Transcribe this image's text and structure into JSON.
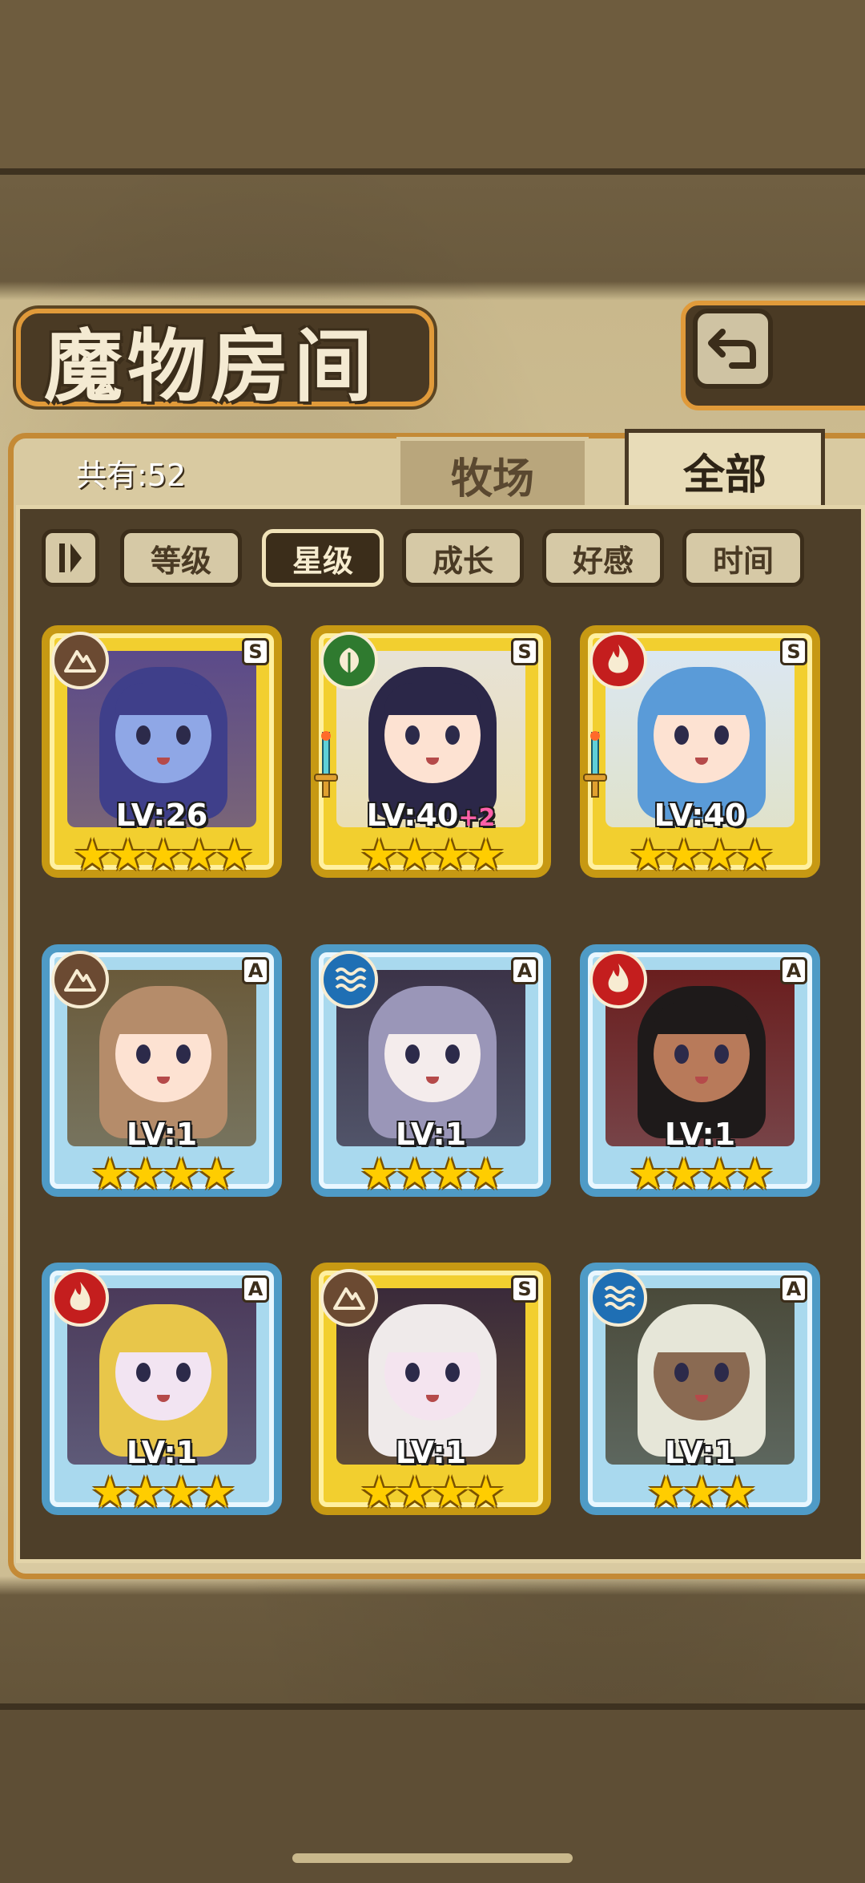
{
  "title": "魔物房间",
  "count_label": "共有:52",
  "tabs": [
    {
      "label": "牧场",
      "active": false
    },
    {
      "label": "全部",
      "active": true
    }
  ],
  "sort_buttons": [
    {
      "label": "等级",
      "active": false
    },
    {
      "label": "星级",
      "active": true
    },
    {
      "label": "成长",
      "active": false
    },
    {
      "label": "好感",
      "active": false
    },
    {
      "label": "时间",
      "active": false
    }
  ],
  "monsters": [
    {
      "level": "LV:26",
      "bonus": "",
      "stars": "★★★★★",
      "rank": "S",
      "element": "earth-icon",
      "frame": "gold",
      "weapon": false,
      "skin": "#8fa7e6",
      "hair": "#3f3f8a",
      "bg": "#5b4a8a"
    },
    {
      "level": "LV:40",
      "bonus": "+2",
      "stars": "★★★★",
      "rank": "S",
      "element": "leaf-icon",
      "frame": "gold",
      "weapon": true,
      "skin": "#fde2d2",
      "hair": "#2b2748",
      "bg": "#e7e2d6"
    },
    {
      "level": "LV:40",
      "bonus": "",
      "stars": "★★★★",
      "rank": "S",
      "element": "fire-icon",
      "frame": "gold",
      "weapon": true,
      "skin": "#fde2d2",
      "hair": "#5a9bd8",
      "bg": "#dbe7f2"
    },
    {
      "level": "LV:1",
      "bonus": "",
      "stars": "★★★★",
      "rank": "A",
      "element": "earth-icon",
      "frame": "blue",
      "weapon": false,
      "skin": "#fde2d2",
      "hair": "#b58c6a",
      "bg": "#6a5a3a"
    },
    {
      "level": "LV:1",
      "bonus": "",
      "stars": "★★★★",
      "rank": "A",
      "element": "water-icon",
      "frame": "blue",
      "weapon": false,
      "skin": "#f4ecec",
      "hair": "#9a96b8",
      "bg": "#3b3348"
    },
    {
      "level": "LV:1",
      "bonus": "",
      "stars": "★★★★",
      "rank": "A",
      "element": "fire-icon",
      "frame": "blue",
      "weapon": false,
      "skin": "#b87a5a",
      "hair": "#1e1a1a",
      "bg": "#6a1e1e"
    },
    {
      "level": "LV:1",
      "bonus": "",
      "stars": "★★★★",
      "rank": "A",
      "element": "fire-icon",
      "frame": "blue",
      "weapon": false,
      "skin": "#f2e4f2",
      "hair": "#e8c64a",
      "bg": "#4b3a5a"
    },
    {
      "level": "LV:1",
      "bonus": "",
      "stars": "★★★★",
      "rank": "S",
      "element": "earth-icon",
      "frame": "gold",
      "weapon": false,
      "skin": "#f4e4ef",
      "hair": "#efeaea",
      "bg": "#3a2a3a"
    },
    {
      "level": "LV:1",
      "bonus": "",
      "stars": "★★★",
      "rank": "A",
      "element": "water-icon",
      "frame": "blue",
      "weapon": false,
      "skin": "#8a6a52",
      "hair": "#e6e6d8",
      "bg": "#4a4a3a"
    }
  ],
  "element_colors": {
    "earth-icon": "#6b4a32",
    "leaf-icon": "#2f7a2f",
    "fire-icon": "#c41e1e",
    "water-icon": "#1f6fb4"
  }
}
